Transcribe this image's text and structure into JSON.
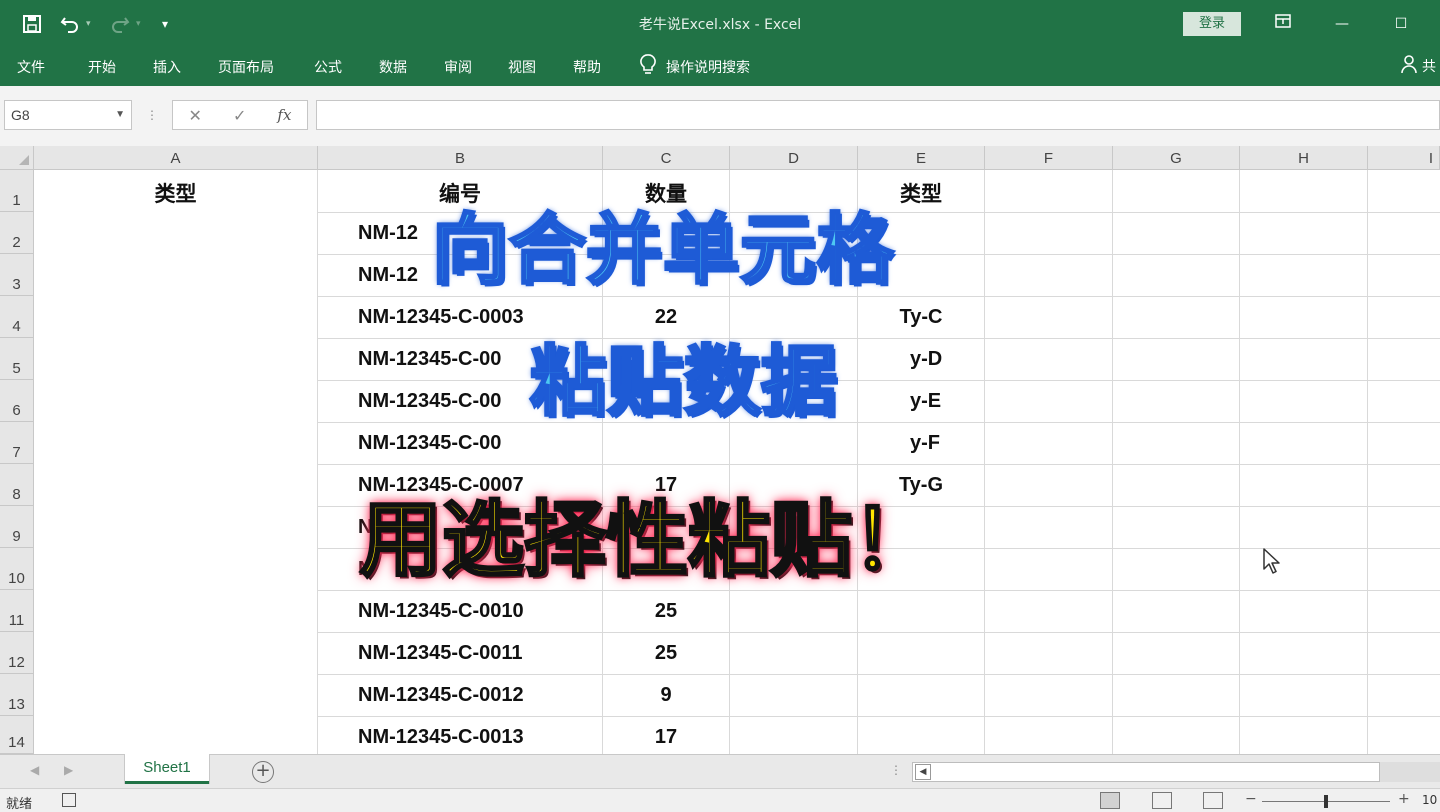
{
  "window": {
    "title": "老牛说Excel.xlsx  -  Excel",
    "login_label": "登录",
    "share_label": "共"
  },
  "ribbon": {
    "tabs": [
      "文件",
      "开始",
      "插入",
      "页面布局",
      "公式",
      "数据",
      "审阅",
      "视图",
      "帮助"
    ],
    "tell_me": "操作说明搜索"
  },
  "formula_bar": {
    "name_box": "G8",
    "fx_label": "fx",
    "formula": ""
  },
  "grid": {
    "columns": [
      "A",
      "B",
      "C",
      "D",
      "E",
      "F",
      "G",
      "H",
      "I"
    ],
    "rows": [
      "1",
      "2",
      "3",
      "4",
      "5",
      "6",
      "7",
      "8",
      "9",
      "10",
      "11",
      "12",
      "13",
      "14"
    ],
    "header_row": {
      "a": "类型",
      "b": "编号",
      "c": "数量",
      "e": "类型"
    },
    "data_rows": [
      {
        "b": "NM-12",
        "c": "",
        "e": ""
      },
      {
        "b": "NM-12",
        "c": "",
        "e": ""
      },
      {
        "b": "NM-12345-C-0003",
        "c": "22",
        "e": "Ty-C"
      },
      {
        "b": "NM-12345-C-00",
        "c": "",
        "e": "y-D"
      },
      {
        "b": "NM-12345-C-00",
        "c": "",
        "e": "y-E"
      },
      {
        "b": "NM-12345-C-00",
        "c": "",
        "e": "y-F"
      },
      {
        "b": "NM-12345-C-0007",
        "c": "17",
        "e": "Ty-G"
      },
      {
        "b": "N",
        "c": "",
        "e": ""
      },
      {
        "b": "N",
        "c": "",
        "e": ""
      },
      {
        "b": "NM-12345-C-0010",
        "c": "25",
        "e": ""
      },
      {
        "b": "NM-12345-C-0011",
        "c": "25",
        "e": ""
      },
      {
        "b": "NM-12345-C-0012",
        "c": "9",
        "e": ""
      },
      {
        "b": "NM-12345-C-0013",
        "c": "17",
        "e": ""
      }
    ]
  },
  "overlay": {
    "line1": "向合并单元格",
    "line2": "粘贴数据",
    "line3": "用选择性粘贴！"
  },
  "sheets": {
    "active": "Sheet1"
  },
  "status": {
    "ready": "就绪",
    "zoom": "10"
  },
  "colors": {
    "excel_green": "#217346",
    "caption_blue": "#4dc8f2",
    "caption_yellow": "#ffe600"
  }
}
